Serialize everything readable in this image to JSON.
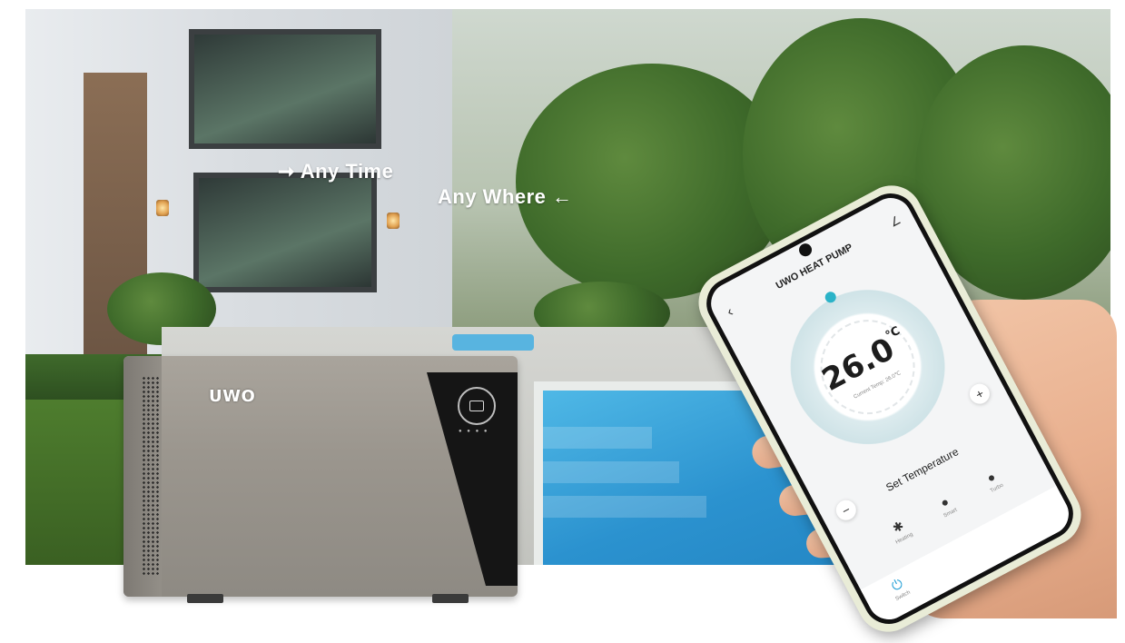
{
  "headline": {
    "line1": "➞ Any Time",
    "line2": "Any Where ←"
  },
  "pump": {
    "brand": "UWO"
  },
  "phone": {
    "app_title": "UWO HEAT PUMP",
    "back_icon": "‹",
    "edit_icon": "∠",
    "temperature": "26.0",
    "temperature_unit": "℃",
    "current_temp_label": "Current Temp: 26.0℃",
    "set_temperature_label": "Set Temperature",
    "minus_label": "−",
    "plus_label": "+",
    "modes": [
      {
        "icon": "✱",
        "label": "Heating"
      },
      {
        "icon": "●",
        "label": "Smart"
      },
      {
        "icon": "●",
        "label": "Turbo"
      }
    ],
    "tabs": [
      {
        "icon": "⏻",
        "label": "Switch"
      }
    ]
  },
  "colors": {
    "pool": "#2b92cf",
    "accent": "#2bb3c8",
    "pump_body": "#9b968e",
    "phone_case": "#e9ecd7"
  },
  "icons": [
    "arrow-right-icon",
    "arrow-left-icon",
    "back-icon",
    "edit-icon",
    "heating-icon",
    "smart-icon",
    "turbo-icon",
    "power-icon"
  ]
}
